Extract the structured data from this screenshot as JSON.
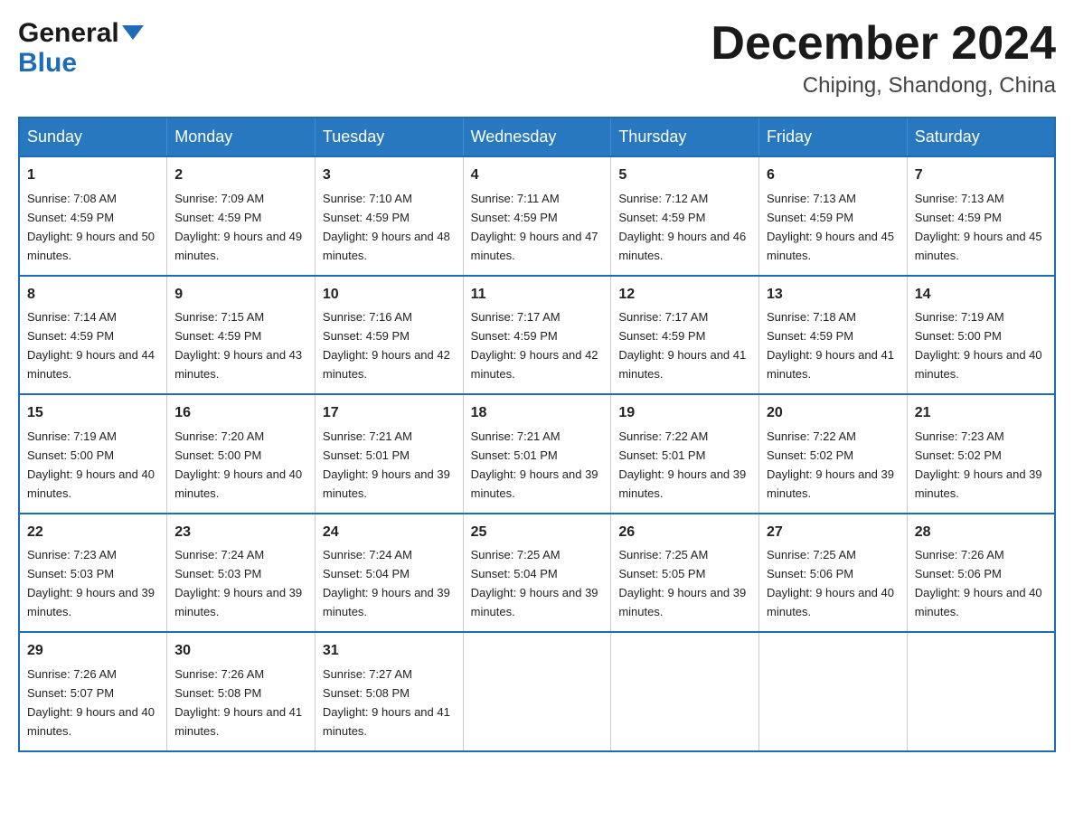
{
  "logo": {
    "line1": "General",
    "line2": "Blue"
  },
  "header": {
    "month": "December 2024",
    "location": "Chiping, Shandong, China"
  },
  "weekdays": [
    "Sunday",
    "Monday",
    "Tuesday",
    "Wednesday",
    "Thursday",
    "Friday",
    "Saturday"
  ],
  "weeks": [
    [
      {
        "day": "1",
        "sunrise": "7:08 AM",
        "sunset": "4:59 PM",
        "daylight": "9 hours and 50 minutes."
      },
      {
        "day": "2",
        "sunrise": "7:09 AM",
        "sunset": "4:59 PM",
        "daylight": "9 hours and 49 minutes."
      },
      {
        "day": "3",
        "sunrise": "7:10 AM",
        "sunset": "4:59 PM",
        "daylight": "9 hours and 48 minutes."
      },
      {
        "day": "4",
        "sunrise": "7:11 AM",
        "sunset": "4:59 PM",
        "daylight": "9 hours and 47 minutes."
      },
      {
        "day": "5",
        "sunrise": "7:12 AM",
        "sunset": "4:59 PM",
        "daylight": "9 hours and 46 minutes."
      },
      {
        "day": "6",
        "sunrise": "7:13 AM",
        "sunset": "4:59 PM",
        "daylight": "9 hours and 45 minutes."
      },
      {
        "day": "7",
        "sunrise": "7:13 AM",
        "sunset": "4:59 PM",
        "daylight": "9 hours and 45 minutes."
      }
    ],
    [
      {
        "day": "8",
        "sunrise": "7:14 AM",
        "sunset": "4:59 PM",
        "daylight": "9 hours and 44 minutes."
      },
      {
        "day": "9",
        "sunrise": "7:15 AM",
        "sunset": "4:59 PM",
        "daylight": "9 hours and 43 minutes."
      },
      {
        "day": "10",
        "sunrise": "7:16 AM",
        "sunset": "4:59 PM",
        "daylight": "9 hours and 42 minutes."
      },
      {
        "day": "11",
        "sunrise": "7:17 AM",
        "sunset": "4:59 PM",
        "daylight": "9 hours and 42 minutes."
      },
      {
        "day": "12",
        "sunrise": "7:17 AM",
        "sunset": "4:59 PM",
        "daylight": "9 hours and 41 minutes."
      },
      {
        "day": "13",
        "sunrise": "7:18 AM",
        "sunset": "4:59 PM",
        "daylight": "9 hours and 41 minutes."
      },
      {
        "day": "14",
        "sunrise": "7:19 AM",
        "sunset": "5:00 PM",
        "daylight": "9 hours and 40 minutes."
      }
    ],
    [
      {
        "day": "15",
        "sunrise": "7:19 AM",
        "sunset": "5:00 PM",
        "daylight": "9 hours and 40 minutes."
      },
      {
        "day": "16",
        "sunrise": "7:20 AM",
        "sunset": "5:00 PM",
        "daylight": "9 hours and 40 minutes."
      },
      {
        "day": "17",
        "sunrise": "7:21 AM",
        "sunset": "5:01 PM",
        "daylight": "9 hours and 39 minutes."
      },
      {
        "day": "18",
        "sunrise": "7:21 AM",
        "sunset": "5:01 PM",
        "daylight": "9 hours and 39 minutes."
      },
      {
        "day": "19",
        "sunrise": "7:22 AM",
        "sunset": "5:01 PM",
        "daylight": "9 hours and 39 minutes."
      },
      {
        "day": "20",
        "sunrise": "7:22 AM",
        "sunset": "5:02 PM",
        "daylight": "9 hours and 39 minutes."
      },
      {
        "day": "21",
        "sunrise": "7:23 AM",
        "sunset": "5:02 PM",
        "daylight": "9 hours and 39 minutes."
      }
    ],
    [
      {
        "day": "22",
        "sunrise": "7:23 AM",
        "sunset": "5:03 PM",
        "daylight": "9 hours and 39 minutes."
      },
      {
        "day": "23",
        "sunrise": "7:24 AM",
        "sunset": "5:03 PM",
        "daylight": "9 hours and 39 minutes."
      },
      {
        "day": "24",
        "sunrise": "7:24 AM",
        "sunset": "5:04 PM",
        "daylight": "9 hours and 39 minutes."
      },
      {
        "day": "25",
        "sunrise": "7:25 AM",
        "sunset": "5:04 PM",
        "daylight": "9 hours and 39 minutes."
      },
      {
        "day": "26",
        "sunrise": "7:25 AM",
        "sunset": "5:05 PM",
        "daylight": "9 hours and 39 minutes."
      },
      {
        "day": "27",
        "sunrise": "7:25 AM",
        "sunset": "5:06 PM",
        "daylight": "9 hours and 40 minutes."
      },
      {
        "day": "28",
        "sunrise": "7:26 AM",
        "sunset": "5:06 PM",
        "daylight": "9 hours and 40 minutes."
      }
    ],
    [
      {
        "day": "29",
        "sunrise": "7:26 AM",
        "sunset": "5:07 PM",
        "daylight": "9 hours and 40 minutes."
      },
      {
        "day": "30",
        "sunrise": "7:26 AM",
        "sunset": "5:08 PM",
        "daylight": "9 hours and 41 minutes."
      },
      {
        "day": "31",
        "sunrise": "7:27 AM",
        "sunset": "5:08 PM",
        "daylight": "9 hours and 41 minutes."
      },
      null,
      null,
      null,
      null
    ]
  ]
}
